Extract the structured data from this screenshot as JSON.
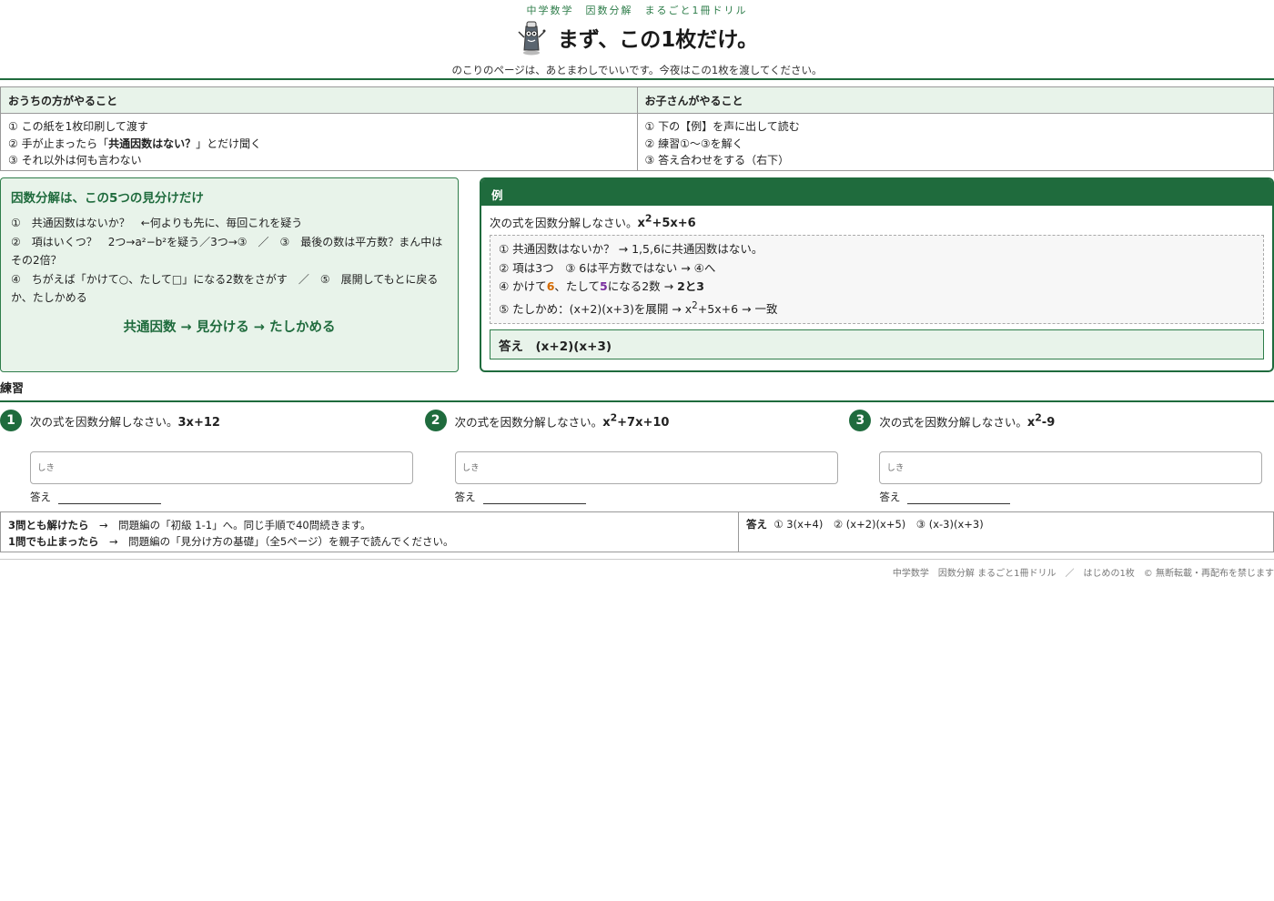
{
  "header": {
    "series": "中学数学　因数分解　まるごと1冊ドリル",
    "title": "まず、この1枚だけ。",
    "subtitle": "のこりのページは、あとまわしでいいです。今夜はこの1枚を渡してください。"
  },
  "roles": {
    "parent": {
      "heading": "おうちの方がやること",
      "items": [
        "① この紙を1枚印刷して渡す",
        "② 手が止まったら「",
        "共通因数はない？",
        "」とだけ聞く",
        "③ それ以外は何も言わない"
      ]
    },
    "child": {
      "heading": "お子さんがやること",
      "items": [
        "① 下の【例】を声に出して読む",
        "② 練習①～③を解く",
        "③ 答え合わせをする（右下）"
      ]
    }
  },
  "see_points": {
    "title": "因数分解は、この5つの見分けだけ",
    "lines": [
      "①　共通因数はないか？　←何よりも先に、毎回これを疑う",
      "②　項はいくつ？　2つ→a²−b²を疑う／3つ→③　／　③　最後の数は平方数？まん中はその2倍？",
      "④　ちがえば「かけて○、たして□」になる2数をさがす　／　⑤　展開してもとに戻るか、たしかめる"
    ],
    "motto": "共通因数 → 見分ける → たしかめる"
  },
  "example": {
    "heading": "例",
    "question_prefix": "次の式を因数分解しなさい。",
    "expr_x": "x",
    "expr_exp": "2",
    "expr_rest": "+5x+6",
    "step1": "① 共通因数はないか？ → 1,5,6に共通因数はない。",
    "step2": "② 項は3つ　③ 6は平方数ではない → ④へ",
    "step4_a": "④ かけて",
    "step4_b": "6",
    "step4_c": "、たして",
    "step4_d": "5",
    "step4_e": "になる2数 → ",
    "step4_f": "2と3",
    "step5_a": "⑤ たしかめ：(x+2)(x+3)を展開 → x",
    "step5_exp": "2",
    "step5_b": "+5x+6 → 一致",
    "answer": "答え　(x+2)(x+3)"
  },
  "practice": {
    "title": "練習",
    "question_prefix": "次の式を因数分解しなさい。",
    "work_placeholder": "しき",
    "answer_label": "答え",
    "problems": [
      {
        "num": "1",
        "expr_a": "3x+12",
        "expr_exp": "",
        "expr_b": ""
      },
      {
        "num": "2",
        "expr_a": "x",
        "expr_exp": "2",
        "expr_b": "+7x+10"
      },
      {
        "num": "3",
        "expr_a": "x",
        "expr_exp": "2",
        "expr_b": "-9"
      }
    ]
  },
  "bottom": {
    "next1_bold": "3問とも解けたら",
    "next1_rest": "　→　問題編の「初級 1-1」へ。同じ手順で40問続きます。",
    "next2_bold": "1問でも止まったら",
    "next2_rest": "　→　問題編の「見分け方の基礎」（全5ページ）を親子で読んでください。",
    "answers_label": "答え",
    "answers": "① 3(x+4)　② (x+2)(x+5)　③ (x-3)(x+3)"
  },
  "footer": "中学数学　因数分解 まるごと1冊ドリル　／　はじめの1枚　© 無断転載・再配布を禁じます",
  "colors": {
    "accent": "#1f6b3d",
    "panel": "#e8f3ea",
    "highlight_orange": "#d46a00",
    "highlight_purple": "#7a2fa0"
  }
}
